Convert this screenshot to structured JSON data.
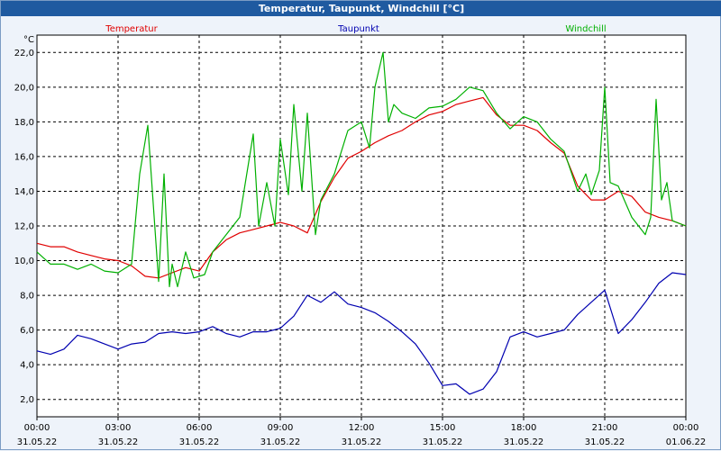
{
  "window": {
    "title": "Temperatur, Taupunkt, Windchill [°C]"
  },
  "chart_data": {
    "type": "line",
    "title": "Temperatur, Taupunkt, Windchill [°C]",
    "ylabel": "°C",
    "ylim": [
      1,
      23
    ],
    "xlim": [
      0,
      24
    ],
    "grid": true,
    "legend_placement": "top",
    "y_ticks": [
      "2,0",
      "4,0",
      "6,0",
      "8,0",
      "10,0",
      "12,0",
      "14,0",
      "16,0",
      "18,0",
      "20,0",
      "22,0"
    ],
    "x_ticks": [
      {
        "time": "00:00",
        "date": "31.05.22"
      },
      {
        "time": "03:00",
        "date": "31.05.22"
      },
      {
        "time": "06:00",
        "date": "31.05.22"
      },
      {
        "time": "09:00",
        "date": "31.05.22"
      },
      {
        "time": "12:00",
        "date": "31.05.22"
      },
      {
        "time": "15:00",
        "date": "31.05.22"
      },
      {
        "time": "18:00",
        "date": "31.05.22"
      },
      {
        "time": "21:00",
        "date": "31.05.22"
      },
      {
        "time": "00:00",
        "date": "01.06.22"
      }
    ],
    "x_unit": "hours since 31.05.22 00:00",
    "series": [
      {
        "name": "Temperatur",
        "color": "#e00000",
        "x": [
          0,
          0.5,
          1,
          1.5,
          2,
          2.5,
          3,
          3.5,
          4,
          4.5,
          5,
          5.5,
          6,
          6.5,
          7,
          7.5,
          8,
          8.5,
          9,
          9.5,
          10,
          10.5,
          11,
          11.5,
          12,
          12.5,
          13,
          13.5,
          14,
          14.5,
          15,
          15.5,
          16,
          16.5,
          17,
          17.5,
          18,
          18.5,
          19,
          19.5,
          20,
          20.5,
          21,
          21.5,
          22,
          22.5,
          23,
          23.5,
          24
        ],
        "values": [
          11.0,
          10.8,
          10.8,
          10.5,
          10.3,
          10.1,
          10.0,
          9.7,
          9.1,
          9.0,
          9.3,
          9.6,
          9.4,
          10.5,
          11.2,
          11.6,
          11.8,
          12.0,
          12.2,
          12.0,
          11.6,
          13.4,
          14.8,
          15.9,
          16.3,
          16.8,
          17.2,
          17.5,
          18.0,
          18.4,
          18.6,
          19.0,
          19.2,
          19.4,
          18.4,
          17.8,
          17.8,
          17.5,
          16.8,
          16.2,
          14.3,
          13.5,
          13.5,
          14.0,
          13.7,
          12.8,
          12.5,
          12.3,
          12.0
        ]
      },
      {
        "name": "Taupunkt",
        "color": "#0000b0",
        "x": [
          0,
          0.5,
          1,
          1.5,
          2,
          2.5,
          3,
          3.5,
          4,
          4.5,
          5,
          5.5,
          6,
          6.5,
          7,
          7.5,
          8,
          8.5,
          9,
          9.5,
          10,
          10.5,
          11,
          11.5,
          12,
          12.5,
          13,
          13.5,
          14,
          14.5,
          15,
          15.5,
          16,
          16.5,
          17,
          17.5,
          18,
          18.5,
          19,
          19.5,
          20,
          20.5,
          21,
          21.5,
          22,
          22.5,
          23,
          23.5,
          24
        ],
        "values": [
          4.8,
          4.6,
          4.9,
          5.7,
          5.5,
          5.2,
          4.9,
          5.2,
          5.3,
          5.8,
          5.9,
          5.8,
          5.9,
          6.2,
          5.8,
          5.6,
          5.9,
          5.9,
          6.1,
          6.8,
          8.0,
          7.6,
          8.2,
          7.5,
          7.3,
          7.0,
          6.5,
          5.9,
          5.2,
          4.1,
          2.8,
          2.9,
          2.3,
          2.6,
          3.6,
          5.6,
          5.9,
          5.6,
          5.8,
          6.0,
          6.9,
          7.6,
          8.3,
          5.8,
          6.6,
          7.6,
          8.7,
          9.3,
          9.2
        ]
      },
      {
        "name": "Windchill",
        "color": "#00b000",
        "x": [
          0,
          0.5,
          1,
          1.5,
          2,
          2.5,
          3,
          3.5,
          3.8,
          4.1,
          4.5,
          4.7,
          4.9,
          5,
          5.2,
          5.5,
          5.8,
          6.2,
          6.5,
          7,
          7.5,
          8,
          8.2,
          8.5,
          8.8,
          9,
          9.3,
          9.5,
          9.8,
          10,
          10.3,
          10.5,
          11,
          11.5,
          12,
          12.3,
          12.5,
          12.8,
          13,
          13.2,
          13.5,
          14,
          14.5,
          15,
          15.5,
          16,
          16.5,
          17,
          17.5,
          18,
          18.5,
          19,
          19.5,
          20,
          20.3,
          20.5,
          20.8,
          21,
          21.2,
          21.5,
          22,
          22.5,
          22.7,
          22.9,
          23.1,
          23.3,
          23.5,
          24
        ],
        "values": [
          10.5,
          9.8,
          9.8,
          9.5,
          9.8,
          9.4,
          9.3,
          9.8,
          15.0,
          17.8,
          8.8,
          15.0,
          8.5,
          9.8,
          8.5,
          10.5,
          9.0,
          9.2,
          10.5,
          11.5,
          12.5,
          17.3,
          12.0,
          14.5,
          12.0,
          17.0,
          13.8,
          19.0,
          14.0,
          18.5,
          11.5,
          13.5,
          15.0,
          17.5,
          18.0,
          16.5,
          20.0,
          22.0,
          18.0,
          19.0,
          18.5,
          18.2,
          18.8,
          18.9,
          19.3,
          20.0,
          19.8,
          18.5,
          17.6,
          18.3,
          18.0,
          17.0,
          16.3,
          14.0,
          15.0,
          13.8,
          15.2,
          20.0,
          14.5,
          14.3,
          12.5,
          11.5,
          12.5,
          19.3,
          13.5,
          14.5,
          12.3,
          12.0
        ]
      }
    ]
  }
}
